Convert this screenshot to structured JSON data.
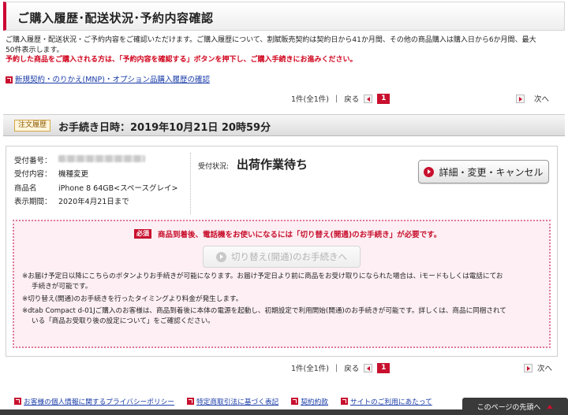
{
  "header": {
    "title": "ご購入履歴･配送状況･予約内容確認"
  },
  "intro": {
    "line1": "ご購入履歴・配送状況・ご予約内容をご確認いただけます。ご購入履歴について、割賦販売契約は契約日から41か月間、その他の商品購入は購入日から6か月間、最大",
    "line2": "50件表示します。",
    "warning": "予約した商品をご購入される方は、「予約内容を確認する」ボタンを押下し、ご購入手続きにお進みください。"
  },
  "links": {
    "history_link": "新規契約・のりかえ(MNP)・オプション品購入履歴の確認"
  },
  "pager": {
    "count": "1件(全1件)",
    "back": "戻る",
    "page": "1",
    "next": "次へ"
  },
  "order": {
    "badge": "注文履歴",
    "title": "お手続き日時：2019年10月21日 20時59分",
    "fields": {
      "receipt_no_label": "受付番号：",
      "content_label": "受付内容：",
      "content_value": "機種変更",
      "product_label": "商品名",
      "product_value": "iPhone 8 64GB<スペースグレイ>",
      "period_label": "表示期間：",
      "period_value": "2020年4月21日まで"
    },
    "status_label": "受付状況:",
    "status_value": "出荷作業待ち",
    "detail_button": "詳細・変更・キャンセル"
  },
  "notice": {
    "must": "必須",
    "headline": "商品到着後、電話機をお使いになるには「切り替え(開通)のお手続き」が必要です。",
    "switch_button": "切り替え(開通)のお手続きへ",
    "note1a": "※お届け予定日以降にこちらのボタンよりお手続きが可能になります。お届け予定日より前に商品をお受け取りになられた場合は、iモードもしくは電話にてお",
    "note1b": "手続きが可能です。",
    "note2": "※切り替え(開通)のお手続きを行ったタイミングより料金が発生します。",
    "note3a": "※dtab Compact d-01Jご購入のお客様は、商品到着後に本体の電源を起動し、初期設定で利用開始(開通)のお手続きが可能です。詳しくは、商品に同梱されて",
    "note3b": "いる「商品お受取り後の設定について」をご確認ください。"
  },
  "footer": {
    "privacy": "お客様の個人情報に関するプライバシーポリシー",
    "law": "特定商取引法に基づく表記",
    "terms": "契約約款",
    "usage": "サイトのご利用にあたって",
    "back_to_top": "このページの先頭へ"
  },
  "colors": {
    "brand": "#c8102e",
    "link": "#1a3ca8",
    "notice_bg": "#fdeff3"
  }
}
